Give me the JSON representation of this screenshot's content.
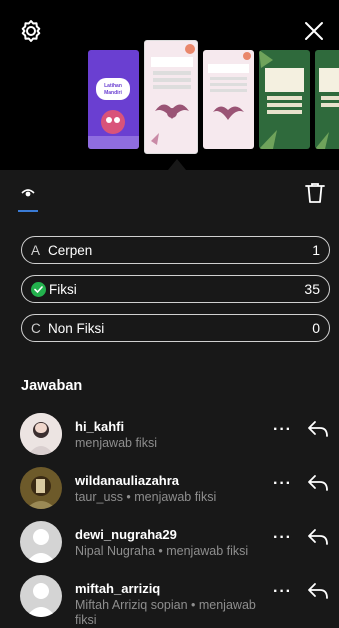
{
  "header": {
    "settings_icon": "settings-gear-icon",
    "close_icon": "close-icon"
  },
  "toolbar": {
    "view_icon": "eye-icon",
    "delete_icon": "trash-icon"
  },
  "thumbnails": [
    {
      "bg": "#6a3fd1",
      "text": "Latihan Mandiri"
    },
    {
      "bg": "#f6e9ee",
      "text": "Latihan Mandiri"
    },
    {
      "bg": "#f6e9ee",
      "text": ""
    },
    {
      "bg": "#2f6a3c",
      "text": ""
    },
    {
      "bg": "#2f6a3c",
      "text": ""
    }
  ],
  "options": [
    {
      "letter": "A",
      "label": "Cerpen",
      "count": "1",
      "correct": false
    },
    {
      "letter": "",
      "label": "Fiksi",
      "count": "35",
      "correct": true
    },
    {
      "letter": "C",
      "label": "Non Fiksi",
      "count": "0",
      "correct": false
    }
  ],
  "answers": {
    "title": "Jawaban",
    "items": [
      {
        "username": "hi_kahfi",
        "detail": "menjawab fiksi"
      },
      {
        "username": "wildanauliazahra",
        "detail": "taur_uss • menjawab fiksi"
      },
      {
        "username": "dewi_nugraha29",
        "detail": "Nipal Nugraha • menjawab fiksi"
      },
      {
        "username": "miftah_arriziq",
        "detail": "Miftah Arriziq sopian • menjawab fiksi"
      }
    ]
  },
  "colors": {
    "accent": "#3a7bd5",
    "correct": "#23b14d",
    "panel": "#181818"
  }
}
